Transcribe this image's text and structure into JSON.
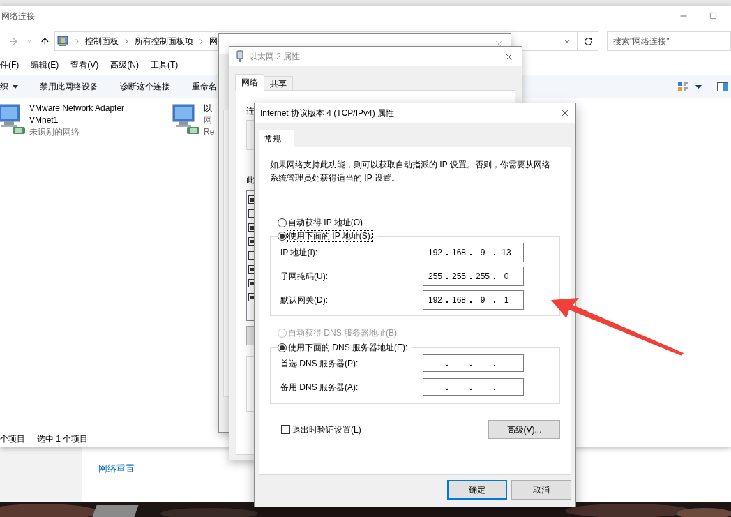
{
  "settings": {
    "link": "网络重置"
  },
  "explorer": {
    "title": "网络连接",
    "breadcrumb": [
      "控制面板",
      "所有控制面板项",
      "网"
    ],
    "search": {
      "placeholder": "搜索\"网络连接\""
    },
    "menu": [
      "件(F)",
      "编辑(E)",
      "查看(V)",
      "高级(N)",
      "工具(T)"
    ],
    "toolbar": [
      "织",
      "禁用此网络设备",
      "诊断这个连接",
      "重命名"
    ],
    "adapters": [
      {
        "name": "VMware Network Adapter VMnet1",
        "status": "未识别的网络"
      },
      {
        "name": "以",
        "status": "网",
        "detail": "Re"
      }
    ],
    "status_bar": [
      "个项目",
      "选中 1 个项目"
    ]
  },
  "properties_dialog": {
    "title": "以太网 2 属性",
    "tabs": [
      {
        "label": "网络",
        "selected": true
      },
      {
        "label": "共享",
        "selected": false
      }
    ],
    "labels": [
      "连",
      "此"
    ],
    "components": [
      {
        "checked": true
      },
      {
        "checked": false
      },
      {
        "checked": true
      },
      {
        "checked": true
      },
      {
        "checked": false
      },
      {
        "checked": true
      },
      {
        "checked": true
      },
      {
        "checked": true
      }
    ]
  },
  "ipv4_dialog": {
    "title": "Internet 协议版本 4 (TCP/IPv4) 属性",
    "tabs": [
      {
        "label": "常规",
        "selected": true
      }
    ],
    "description": "如果网络支持此功能，则可以获取自动指派的 IP 设置。否则，你需要从网络系统管理员处获得适当的 IP 设置。",
    "ip_mode": [
      {
        "label": "自动获得 IP 地址(O)",
        "selected": false,
        "disabled": false,
        "focused": false
      },
      {
        "label": "使用下面的 IP 地址(S):",
        "selected": true,
        "disabled": false,
        "focused": true
      }
    ],
    "ip_fields": [
      {
        "label": "IP 地址(I):",
        "octets": [
          "192",
          "168",
          "9",
          "13"
        ]
      },
      {
        "label": "子网掩码(U):",
        "octets": [
          "255",
          "255",
          "255",
          "0"
        ]
      },
      {
        "label": "默认网关(D):",
        "octets": [
          "192",
          "168",
          "9",
          "1"
        ]
      }
    ],
    "dns_mode": [
      {
        "label": "自动获得 DNS 服务器地址(B)",
        "selected": false,
        "disabled": true,
        "focused": false
      },
      {
        "label": "使用下面的 DNS 服务器地址(E):",
        "selected": true,
        "disabled": false,
        "focused": false
      }
    ],
    "dns_fields": [
      {
        "label": "首选 DNS 服务器(P):"
      },
      {
        "label": "备用 DNS 服务器(A):"
      }
    ],
    "validate": {
      "label": "退出时验证设置(L)",
      "checked": false
    },
    "advanced_button": "高级(V)...",
    "buttons": [
      {
        "label": "确定",
        "default": true
      },
      {
        "label": "取消",
        "default": false
      }
    ]
  }
}
